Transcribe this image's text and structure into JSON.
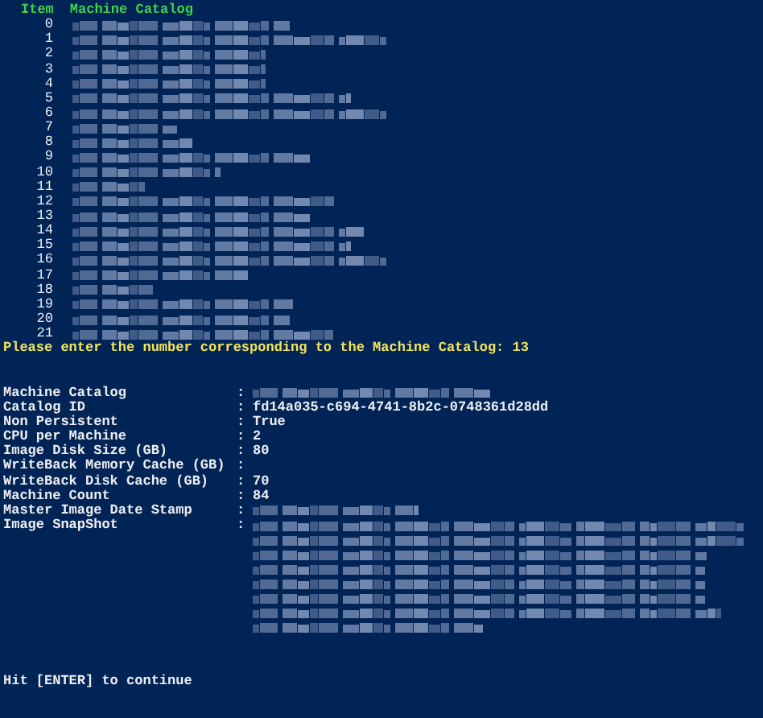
{
  "table": {
    "columns": [
      "Item",
      "Machine Catalog"
    ],
    "rows": [
      {
        "item": "0"
      },
      {
        "item": "1"
      },
      {
        "item": "2"
      },
      {
        "item": "3"
      },
      {
        "item": "4"
      },
      {
        "item": "5"
      },
      {
        "item": "6"
      },
      {
        "item": "7"
      },
      {
        "item": "8"
      },
      {
        "item": "9"
      },
      {
        "item": "10"
      },
      {
        "item": "11"
      },
      {
        "item": "12"
      },
      {
        "item": "13"
      },
      {
        "item": "14"
      },
      {
        "item": "15"
      },
      {
        "item": "16"
      },
      {
        "item": "17"
      },
      {
        "item": "18"
      },
      {
        "item": "19"
      },
      {
        "item": "20"
      },
      {
        "item": "21"
      }
    ]
  },
  "prompt": "Please enter the number corresponding to the Machine Catalog: 13",
  "details": [
    {
      "label": "Machine Catalog",
      "separator": ":",
      "kind": "redacted"
    },
    {
      "label": "Catalog ID",
      "separator": ":",
      "kind": "text",
      "value": "fd14a035-c694-4741-8b2c-0748361d28dd"
    },
    {
      "label": "Non Persistent",
      "separator": ":",
      "kind": "text",
      "value": "True"
    },
    {
      "label": "CPU per Machine",
      "separator": ":",
      "kind": "text",
      "value": "2"
    },
    {
      "label": "Image Disk Size (GB)",
      "separator": ":",
      "kind": "text",
      "value": "80"
    },
    {
      "label": "WriteBack Memory Cache (GB)",
      "separator": ":",
      "kind": "empty"
    },
    {
      "label": "WriteBack Disk Cache (GB)",
      "separator": ":",
      "kind": "text",
      "value": "70"
    },
    {
      "label": "Machine Count",
      "separator": ":",
      "kind": "text",
      "value": "84"
    },
    {
      "label": "Master Image Date Stamp",
      "separator": ":",
      "kind": "redacted"
    },
    {
      "label": "Image SnapShot",
      "separator": ":",
      "kind": "redacted_block"
    }
  ],
  "footer": "Hit [ENTER] to continue"
}
